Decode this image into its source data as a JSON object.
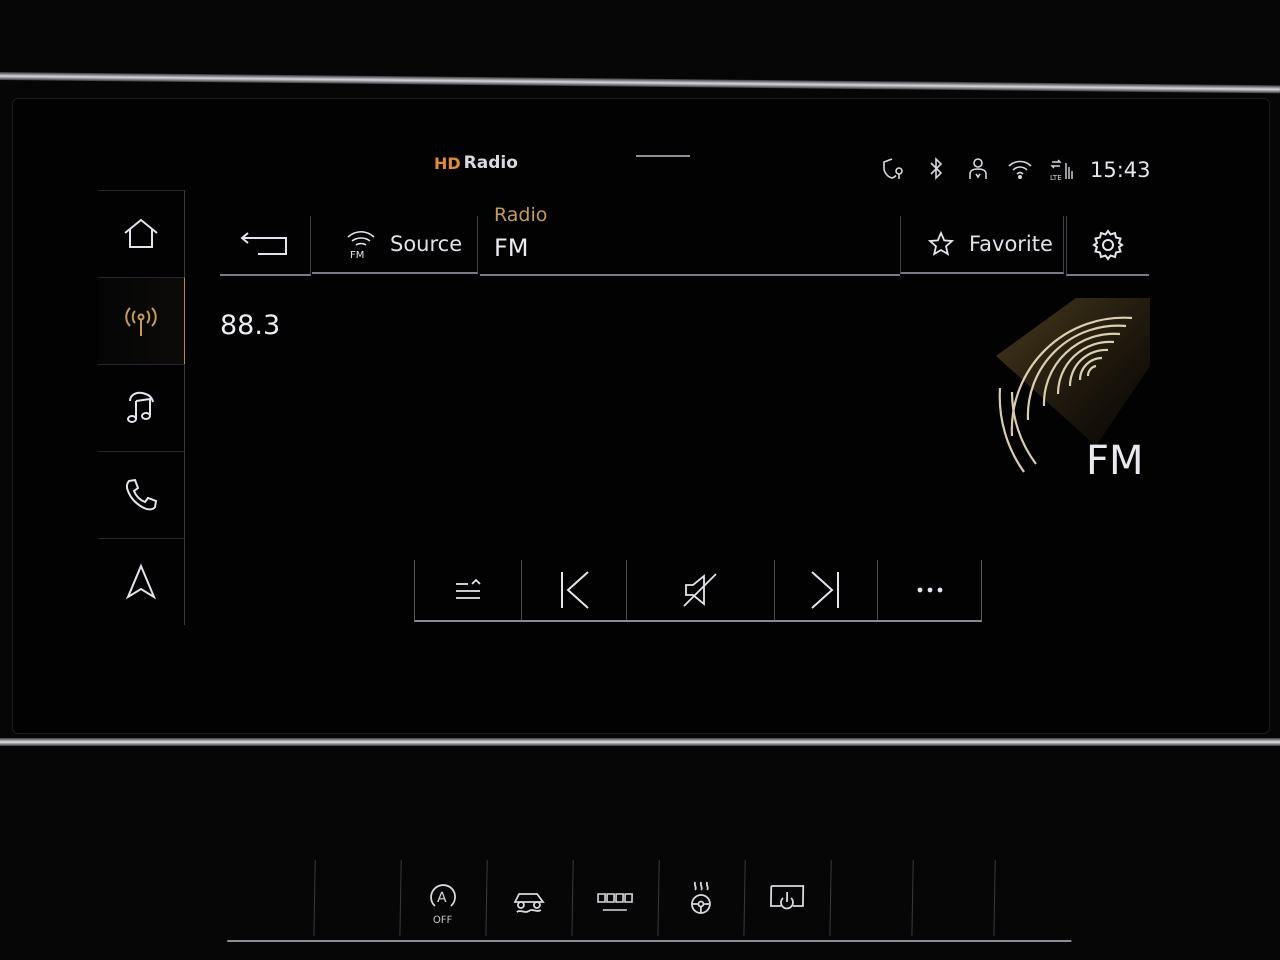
{
  "status": {
    "hd_badge": "HD",
    "hd_text": "Radio",
    "time": "15:43"
  },
  "header": {
    "source_icon_caption": "FM",
    "source_label": "Source",
    "title": "Radio",
    "subtitle": "FM",
    "favorite_label": "Favorite"
  },
  "station": {
    "frequency": "88.3",
    "band_label": "FM"
  },
  "nav": {
    "items": [
      "home-icon",
      "radio-icon",
      "music-icon",
      "phone-icon",
      "navigation-icon"
    ],
    "active_index": 1
  },
  "transport": {
    "buttons": [
      "list-icon",
      "previous-icon",
      "mute-icon",
      "next-icon",
      "more-icon"
    ]
  },
  "strip": {
    "auto_off_letter": "A",
    "auto_off_text": "OFF"
  },
  "colors": {
    "accent_gold": "#c59a5c",
    "hd_orange": "#e08a3a",
    "background": "#020203"
  }
}
